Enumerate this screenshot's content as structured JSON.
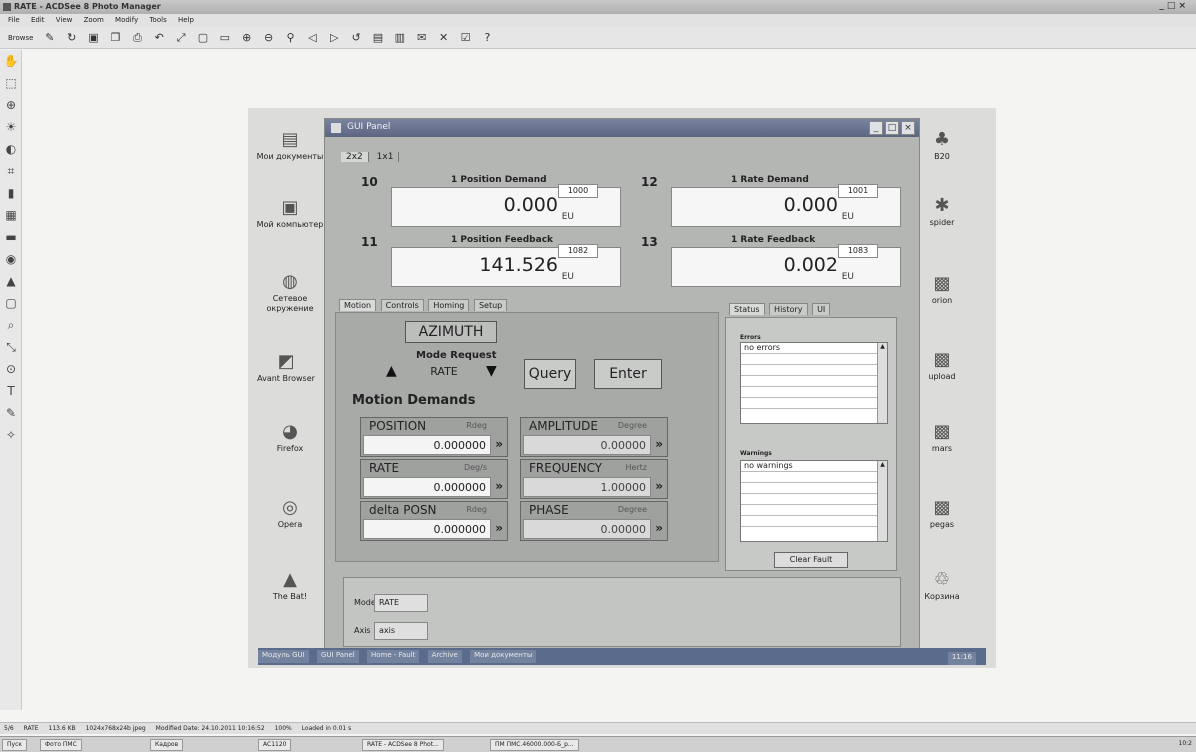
{
  "app": {
    "title": "RATE - ACDSee 8 Photo Manager",
    "menu": [
      "File",
      "Edit",
      "View",
      "Zoom",
      "Modify",
      "Tools",
      "Help"
    ],
    "toolbar_browse_label": "Browse",
    "window_controls": "_ □ ×"
  },
  "desktop": {
    "icons": [
      {
        "label": "Мои документы"
      },
      {
        "label": "Мой компьютер"
      },
      {
        "label": "Сетевое окружение"
      },
      {
        "label": "Avant Browser"
      },
      {
        "label": "Firefox"
      },
      {
        "label": "Opera"
      },
      {
        "label": "The Bat!"
      },
      {
        "label": "B20"
      },
      {
        "label": "spider"
      },
      {
        "label": "orion"
      },
      {
        "label": "upload"
      },
      {
        "label": "mars"
      },
      {
        "label": "pegas"
      },
      {
        "label": "Корзина"
      }
    ]
  },
  "gui": {
    "title": "GUI Panel",
    "top_tabs": [
      "2x2",
      "1x1"
    ],
    "readouts": [
      {
        "id": "10",
        "channel": "1",
        "label": "Position Demand",
        "value": "0.000",
        "unit": "EU",
        "code": "1000"
      },
      {
        "id": "12",
        "channel": "1",
        "label": "Rate Demand",
        "value": "0.000",
        "unit": "EU",
        "code": "1001"
      },
      {
        "id": "11",
        "channel": "1",
        "label": "Position Feedback",
        "value": "141.526",
        "unit": "EU",
        "code": "1082"
      },
      {
        "id": "13",
        "channel": "1",
        "label": "Rate Feedback",
        "value": "0.002",
        "unit": "EU",
        "code": "1083"
      }
    ],
    "left_tabs": [
      "Motion",
      "Controls",
      "Homing",
      "Setup"
    ],
    "right_tabs": [
      "Status",
      "History",
      "UI"
    ],
    "axis_name": "AZIMUTH",
    "mode_request_label": "Mode Request",
    "mode_value": "RATE",
    "query_label": "Query",
    "enter_label": "Enter",
    "motion_demands_label": "Motion Demands",
    "demands": [
      {
        "name": "POSITION",
        "unit": "Rdeg",
        "value": "0.000000"
      },
      {
        "name": "AMPLITUDE",
        "unit": "Degree",
        "value": "0.00000"
      },
      {
        "name": "RATE",
        "unit": "Deg/s",
        "value": "0.000000"
      },
      {
        "name": "FREQUENCY",
        "unit": "Hertz",
        "value": "1.00000"
      },
      {
        "name": "delta POSN",
        "unit": "Rdeg",
        "value": "0.000000"
      },
      {
        "name": "PHASE",
        "unit": "Degree",
        "value": "0.00000"
      }
    ],
    "go_glyph": "»",
    "errors_label": "Errors",
    "errors_first": "no errors",
    "warnings_label": "Warnings",
    "warnings_first": "no warnings",
    "clear_fault_label": "Clear Fault",
    "bottom_mode_label": "Mode",
    "bottom_mode_value": "RATE",
    "bottom_axis_label": "Axis",
    "bottom_axis_value": "axis"
  },
  "inner_taskbar": {
    "items": [
      "Модуль GUI",
      "GUI Panel",
      "Home - Fault",
      "Archive",
      "Мои документы"
    ],
    "time": "11:16"
  },
  "statusbar": {
    "items": [
      "5/6",
      "RATE",
      "113.6 KB",
      "1024x768x24b jpeg",
      "Modified Date: 24.10.2011 10:16:52",
      "100%",
      "Loaded in 0.01 s"
    ]
  },
  "taskbar": {
    "items": [
      "Пуск",
      "Фото ПМС",
      "Кадров",
      "AC1120",
      "RATE - ACDSee 8 Phot...",
      "ПМ ПМС.46000.000-Б_р..."
    ],
    "time": "10:2"
  },
  "colors": {
    "gui_bg": "#b4b6b4",
    "title_bar": "#5c6682",
    "taskbar": "#5b6b8c"
  }
}
